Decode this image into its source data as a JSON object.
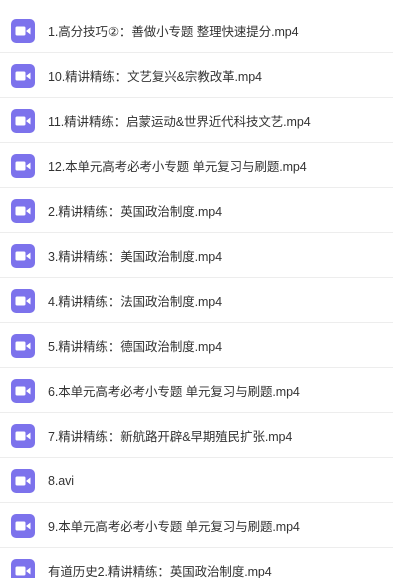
{
  "colors": {
    "video_icon_bg": "#7c72ec",
    "text": "#333333",
    "divider": "#ededed"
  },
  "files": [
    {
      "name": "1.高分技巧②：善做小专题 整理快速提分.mp4",
      "icon": "video-file-icon"
    },
    {
      "name": "10.精讲精练：文艺复兴&宗教改革.mp4",
      "icon": "video-file-icon"
    },
    {
      "name": "11.精讲精练：启蒙运动&世界近代科技文艺.mp4",
      "icon": "video-file-icon"
    },
    {
      "name": "12.本单元高考必考小专题 单元复习与刷题.mp4",
      "icon": "video-file-icon"
    },
    {
      "name": "2.精讲精练：英国政治制度.mp4",
      "icon": "video-file-icon"
    },
    {
      "name": "3.精讲精练：美国政治制度.mp4",
      "icon": "video-file-icon"
    },
    {
      "name": "4.精讲精练：法国政治制度.mp4",
      "icon": "video-file-icon"
    },
    {
      "name": "5.精讲精练：德国政治制度.mp4",
      "icon": "video-file-icon"
    },
    {
      "name": "6.本单元高考必考小专题 单元复习与刷题.mp4",
      "icon": "video-file-icon"
    },
    {
      "name": "7.精讲精练：新航路开辟&早期殖民扩张.mp4",
      "icon": "video-file-icon"
    },
    {
      "name": "8.avi",
      "icon": "video-file-icon"
    },
    {
      "name": "9.本单元高考必考小专题 单元复习与刷题.mp4",
      "icon": "video-file-icon"
    },
    {
      "name": "有道历史2.精讲精练：英国政治制度.mp4",
      "icon": "video-file-icon"
    }
  ]
}
